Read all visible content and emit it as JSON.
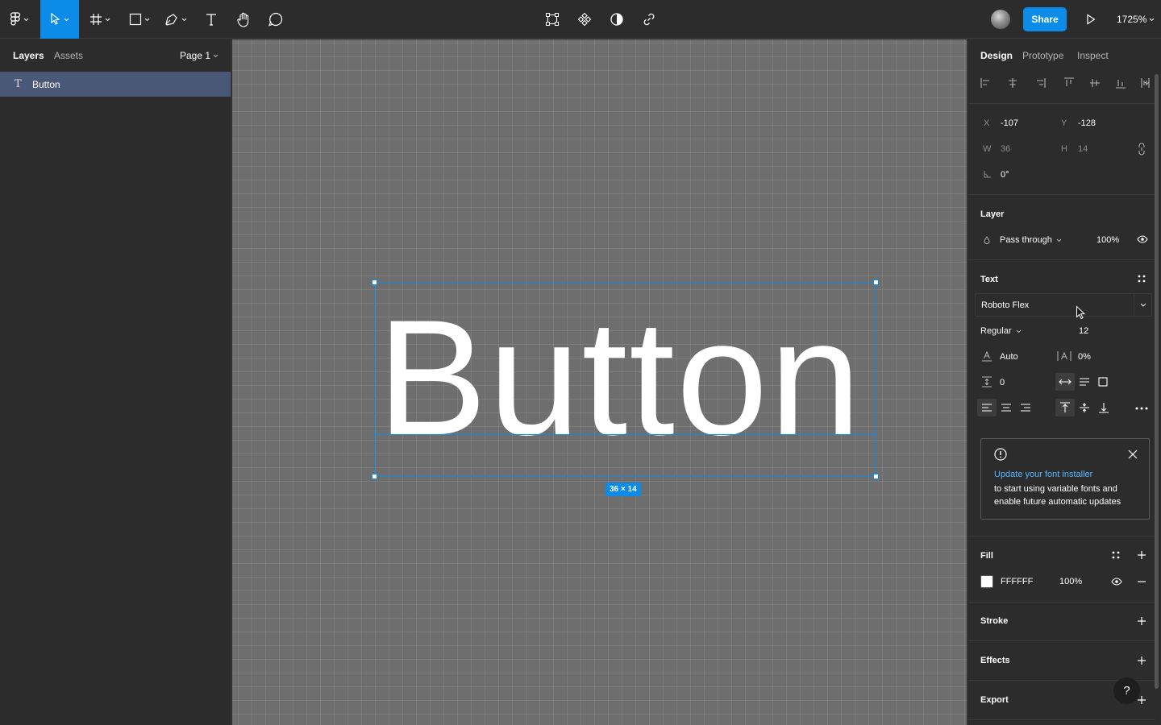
{
  "toolbar": {
    "tools": [
      "main-menu",
      "move",
      "frame",
      "shape",
      "pen",
      "text",
      "hand",
      "comment"
    ],
    "share_label": "Share",
    "zoom_label": "1725%"
  },
  "left_panel": {
    "tabs": [
      "Layers",
      "Assets"
    ],
    "page_label": "Page 1",
    "layers": [
      {
        "type": "T",
        "name": "Button"
      }
    ]
  },
  "canvas": {
    "text_content": "Button",
    "size_badge": "36 × 14",
    "selection_color": "#0c8ce9",
    "background": "#6e6e6e"
  },
  "right_panel": {
    "tabs": [
      "Design",
      "Prototype",
      "Inspect"
    ],
    "position": {
      "x_label": "X",
      "x": "-107",
      "y_label": "Y",
      "y": "-128"
    },
    "size": {
      "w_label": "W",
      "w": "36",
      "h_label": "H",
      "h": "14"
    },
    "rotation": "0°",
    "layer": {
      "title": "Layer",
      "blend": "Pass through",
      "opacity": "100%"
    },
    "text": {
      "title": "Text",
      "font_family": "Roboto Flex",
      "font_style": "Regular",
      "font_size": "12",
      "line_height": "Auto",
      "letter_spacing": "0%",
      "paragraph_spacing": "0"
    },
    "notice": {
      "link": "Update your font installer",
      "body": "to start using variable fonts and enable future automatic updates"
    },
    "fill": {
      "title": "Fill",
      "hex": "FFFFFF",
      "opacity": "100%",
      "color": "#ffffff"
    },
    "stroke": {
      "title": "Stroke"
    },
    "effects": {
      "title": "Effects"
    },
    "export": {
      "title": "Export"
    },
    "help": "?"
  }
}
